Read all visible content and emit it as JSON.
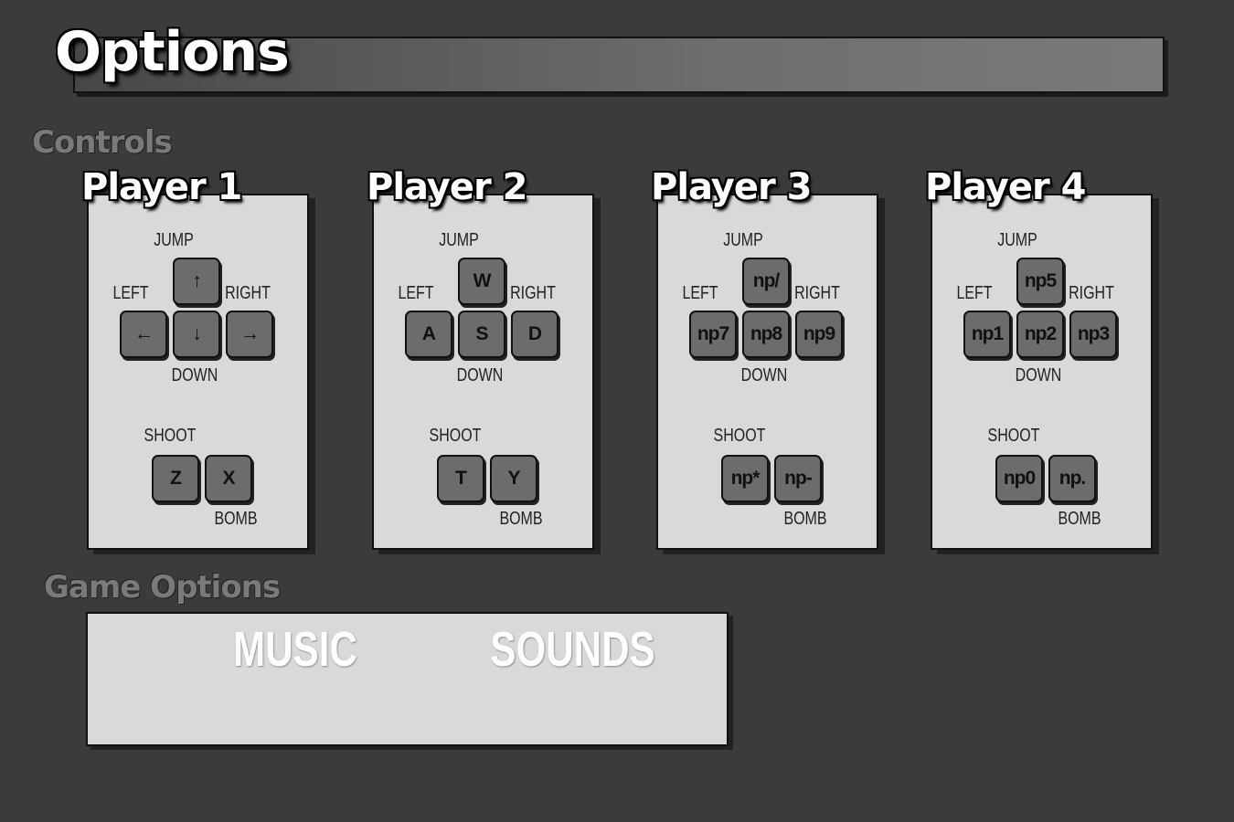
{
  "header": {
    "title": "Options"
  },
  "sections": {
    "controls": "Controls",
    "game_options": "Game Options"
  },
  "labels": {
    "jump": "JUMP",
    "left": "LEFT",
    "right": "RIGHT",
    "down": "DOWN",
    "shoot": "SHOOT",
    "bomb": "BOMB"
  },
  "players": [
    {
      "name": "Player 1",
      "keys": {
        "jump": "↑",
        "left": "←",
        "down": "↓",
        "right": "→",
        "shoot": "Z",
        "bomb": "X"
      }
    },
    {
      "name": "Player 2",
      "keys": {
        "jump": "W",
        "left": "A",
        "down": "S",
        "right": "D",
        "shoot": "T",
        "bomb": "Y"
      }
    },
    {
      "name": "Player 3",
      "keys": {
        "jump": "np/",
        "left": "np7",
        "down": "np8",
        "right": "np9",
        "shoot": "np*",
        "bomb": "np-"
      }
    },
    {
      "name": "Player 4",
      "keys": {
        "jump": "np5",
        "left": "np1",
        "down": "np2",
        "right": "np3",
        "shoot": "np0",
        "bomb": "np."
      }
    }
  ],
  "game_options": {
    "music": "MUSIC",
    "sounds": "SOUNDS"
  }
}
